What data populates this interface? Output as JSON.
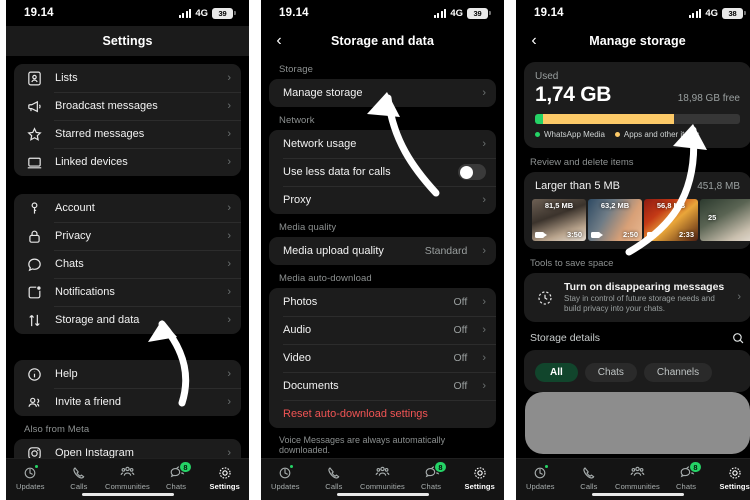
{
  "statusbar": {
    "time": "19.14",
    "network": "4G",
    "battery_p1": "39",
    "battery_p2": "39",
    "battery_p3": "38"
  },
  "tabbar": {
    "items": [
      {
        "label": "Updates",
        "icon": "updates-icon",
        "badge_dot": true
      },
      {
        "label": "Calls",
        "icon": "phone-icon"
      },
      {
        "label": "Communities",
        "icon": "communities-icon"
      },
      {
        "label": "Chats",
        "icon": "chats-icon",
        "badge": "8"
      },
      {
        "label": "Settings",
        "icon": "gear-icon",
        "active": true
      }
    ]
  },
  "panel1": {
    "title": "Settings",
    "groups": [
      {
        "label": "",
        "rows": [
          {
            "label": "Lists",
            "icon": "lists-icon",
            "chevron": true
          },
          {
            "label": "Broadcast messages",
            "icon": "megaphone-icon",
            "chevron": true
          },
          {
            "label": "Starred messages",
            "icon": "star-icon",
            "chevron": true
          },
          {
            "label": "Linked devices",
            "icon": "laptop-icon",
            "chevron": true
          }
        ]
      },
      {
        "label": "",
        "rows": [
          {
            "label": "Account",
            "icon": "key-icon",
            "chevron": true
          },
          {
            "label": "Privacy",
            "icon": "lock-icon",
            "chevron": true
          },
          {
            "label": "Chats",
            "icon": "chat-bubble-icon",
            "chevron": true
          },
          {
            "label": "Notifications",
            "icon": "notification-icon",
            "chevron": true
          },
          {
            "label": "Storage and data",
            "icon": "storage-arrows-icon",
            "chevron": true
          }
        ]
      },
      {
        "label": "",
        "rows": [
          {
            "label": "Help",
            "icon": "info-icon",
            "chevron": true
          },
          {
            "label": "Invite a friend",
            "icon": "people-icon",
            "chevron": true
          }
        ]
      },
      {
        "label": "Also from Meta",
        "rows": [
          {
            "label": "Open Instagram",
            "icon": "instagram-icon",
            "chevron": true
          }
        ]
      }
    ]
  },
  "panel2": {
    "title": "Storage and data",
    "back_icon": "chevron-left-icon",
    "groups": [
      {
        "label": "Storage",
        "rows": [
          {
            "label": "Manage storage",
            "chevron": true
          }
        ]
      },
      {
        "label": "Network",
        "rows": [
          {
            "label": "Network usage",
            "chevron": true
          },
          {
            "label": "Use less data for calls",
            "toggle": "off"
          },
          {
            "label": "Proxy",
            "chevron": true
          }
        ]
      },
      {
        "label": "Media quality",
        "rows": [
          {
            "label": "Media upload quality",
            "value": "Standard",
            "chevron": true
          }
        ]
      },
      {
        "label": "Media auto-download",
        "rows": [
          {
            "label": "Photos",
            "value": "Off",
            "chevron": true
          },
          {
            "label": "Audio",
            "value": "Off",
            "chevron": true
          },
          {
            "label": "Video",
            "value": "Off",
            "chevron": true
          },
          {
            "label": "Documents",
            "value": "Off",
            "chevron": true
          },
          {
            "label": "Reset auto-download settings",
            "danger": true
          }
        ]
      }
    ],
    "footnote": "Voice Messages are always automatically downloaded."
  },
  "panel3": {
    "title": "Manage storage",
    "back_icon": "chevron-left-icon",
    "used": {
      "label": "Used",
      "amount": "1,74 GB",
      "free": "18,98 GB free",
      "bar": {
        "green_pct": 4,
        "orange_pct": 64
      },
      "legend": [
        {
          "label": "WhatsApp Media",
          "color": "#25d366"
        },
        {
          "label": "Apps and other items",
          "color": "#fcc967"
        }
      ]
    },
    "review": {
      "section_label": "Review and delete items",
      "title": "Larger than 5 MB",
      "size": "451,8 MB",
      "thumbs": [
        {
          "size": "81,5 MB",
          "duration": "3:50"
        },
        {
          "size": "63,2 MB",
          "duration": "2:50"
        },
        {
          "size": "56,8 MB",
          "duration": "2:33"
        },
        {
          "size": "25",
          "duration": ""
        }
      ]
    },
    "tools": {
      "section_label": "Tools to save space",
      "title": "Turn on disappearing messages",
      "subtitle": "Stay in control of future storage needs and build privacy into your chats.",
      "icon": "timer-icon",
      "chevron": true
    },
    "details": {
      "section_label": "Storage details",
      "search_icon": "search-icon",
      "chips": [
        {
          "label": "All",
          "selected": true
        },
        {
          "label": "Chats",
          "selected": false
        },
        {
          "label": "Channels",
          "selected": false
        }
      ]
    }
  },
  "colors": {
    "accent_green": "#25d366",
    "orange": "#fcc967",
    "danger_red": "#f05454",
    "card_bg": "#1c1c1c",
    "page_bg": "#000000"
  }
}
